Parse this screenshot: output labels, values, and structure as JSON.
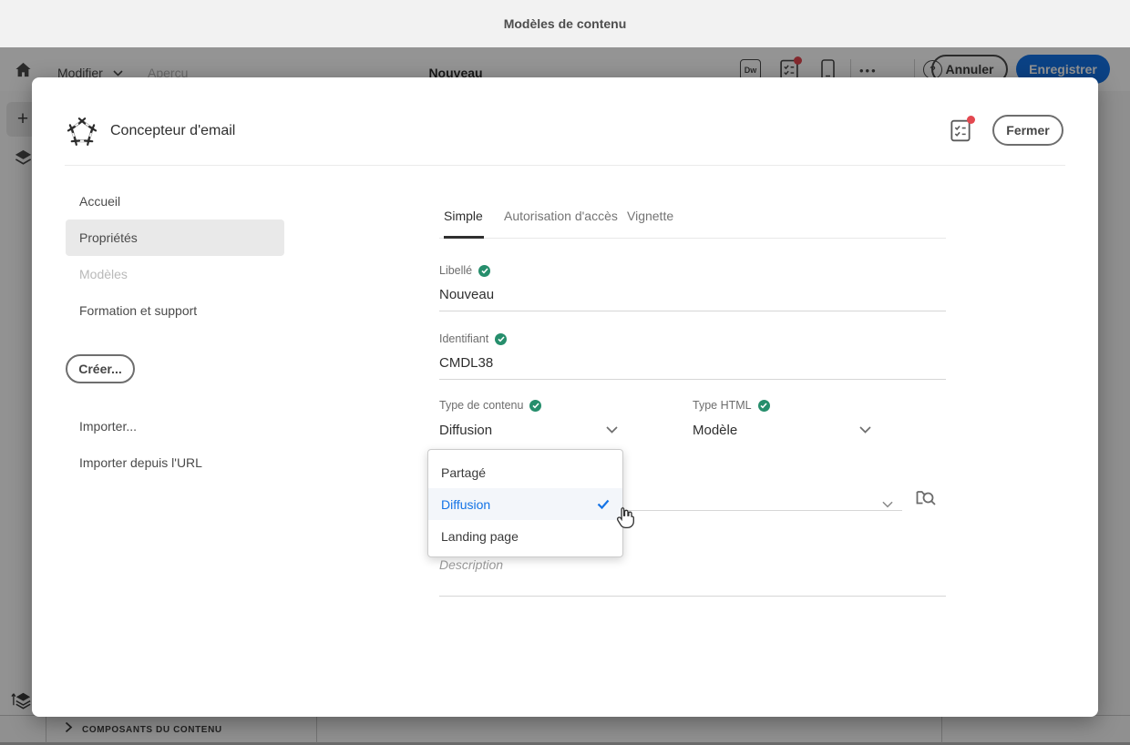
{
  "header": {
    "title": "Modèles de contenu"
  },
  "toolbar": {
    "modifier_label": "Modifier",
    "apercu_label": "Aperçu",
    "document_title": "Nouveau",
    "annuler_label": "Annuler",
    "enregistrer_label": "Enregistrer"
  },
  "icons": {
    "dw": "Dw",
    "more": "•••",
    "help": "?",
    "plus": "+"
  },
  "workspace": {
    "components_panel_label": "COMPOSANTS DU CONTENU"
  },
  "modal": {
    "title": "Concepteur d'email",
    "close_label": "Fermer",
    "nav": {
      "items": [
        {
          "label": "Accueil",
          "state": "normal"
        },
        {
          "label": "Propriétés",
          "state": "selected"
        },
        {
          "label": "Modèles",
          "state": "disabled"
        },
        {
          "label": "Formation et support",
          "state": "normal"
        }
      ],
      "create_label": "Créer...",
      "import_label": "Importer...",
      "import_url_label": "Importer depuis l'URL"
    },
    "tabs": [
      {
        "label": "Simple",
        "active": true
      },
      {
        "label": "Autorisation d'accès",
        "active": false
      },
      {
        "label": "Vignette",
        "active": false
      }
    ],
    "form": {
      "libelle": {
        "label": "Libellé",
        "value": "Nouveau",
        "valid": true
      },
      "identifiant": {
        "label": "Identifiant",
        "value": "CMDL38",
        "valid": true
      },
      "type_contenu": {
        "label": "Type de contenu",
        "value": "Diffusion",
        "valid": true
      },
      "type_html": {
        "label": "Type HTML",
        "value": "Modèle",
        "valid": true
      },
      "description": {
        "placeholder": "Description"
      }
    },
    "dropdown": {
      "options": [
        {
          "label": "Partagé",
          "selected": false
        },
        {
          "label": "Diffusion",
          "selected": true
        },
        {
          "label": "Landing page",
          "selected": false
        }
      ]
    }
  },
  "colors": {
    "accent_blue": "#1473e6",
    "valid_green": "#268e6c",
    "notification_red": "#e34850"
  }
}
